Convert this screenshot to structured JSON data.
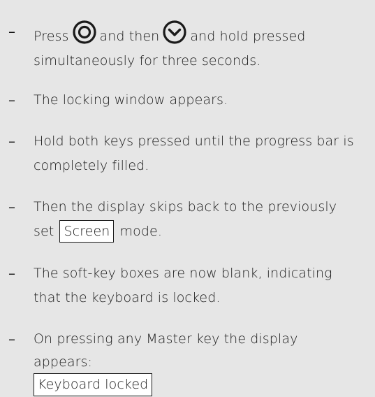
{
  "steps": [
    {
      "id": "step1",
      "parts": {
        "press": "Press",
        "and_then": "and then",
        "hold": "and hold pressed",
        "line2": "simultaneously for three seconds."
      },
      "icons": [
        "target-key-icon",
        "chevron-down-key-icon"
      ]
    },
    {
      "id": "step2",
      "line1": "The locking window appears."
    },
    {
      "id": "step3",
      "line1": "Hold both keys pressed until the progress bar is",
      "line2": "completely filled."
    },
    {
      "id": "step4",
      "line1": "Then the display skips back to the previously",
      "pre": "set",
      "boxed": "Screen",
      "post": "mode."
    },
    {
      "id": "step5",
      "line1": "The soft-key boxes are now blank, indicating",
      "line2": "that the keyboard is locked."
    },
    {
      "id": "step6",
      "line1": "On pressing any Master key the display",
      "line2": "appears:",
      "boxed": "Keyboard locked"
    }
  ],
  "dash_char": "–"
}
